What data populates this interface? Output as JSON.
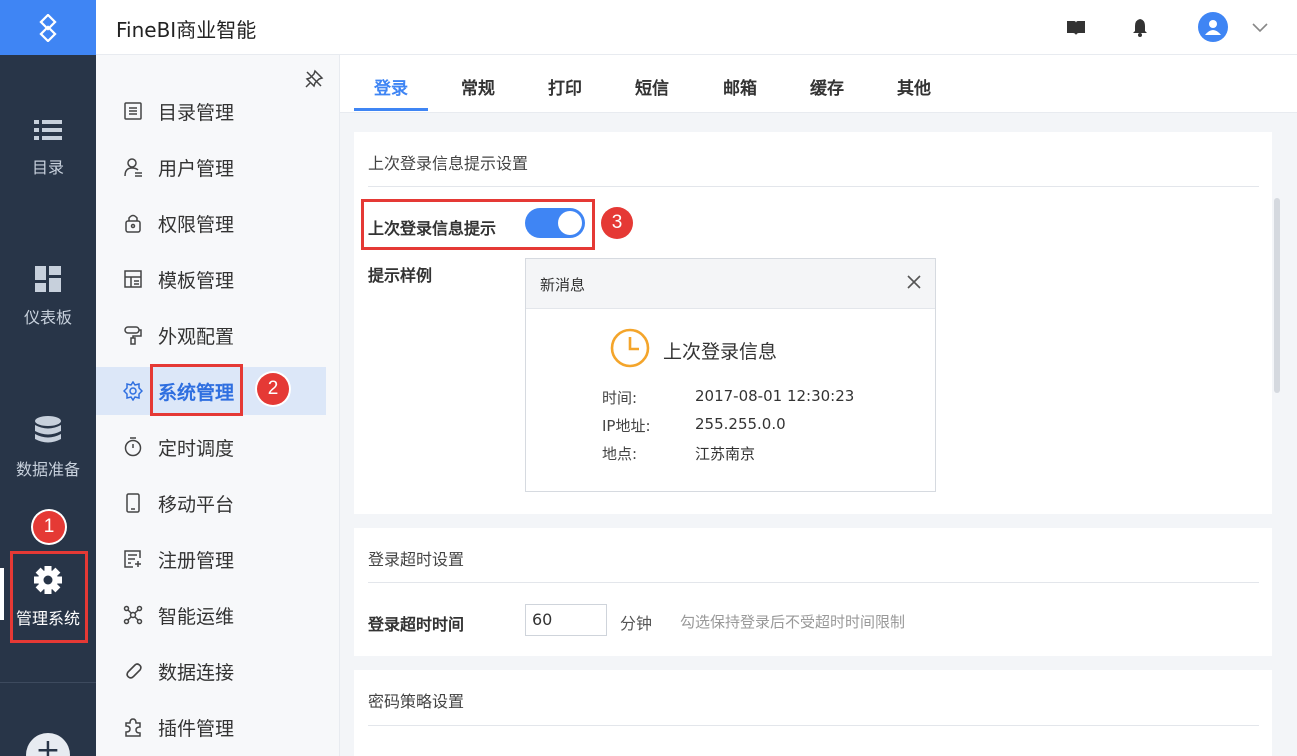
{
  "app": {
    "title": "FineBI商业智能"
  },
  "header": {
    "username": "",
    "icons": [
      "book-icon",
      "bell-icon",
      "user-avatar-icon",
      "chevron-down-icon"
    ]
  },
  "rail": {
    "items": [
      {
        "label": "目录",
        "icon": "list-icon"
      },
      {
        "label": "仪表板",
        "icon": "dashboard-icon"
      },
      {
        "label": "数据准备",
        "icon": "database-icon"
      },
      {
        "label": "管理系统",
        "icon": "gear-icon"
      }
    ],
    "plus": "+"
  },
  "menu": {
    "items": [
      {
        "label": "目录管理",
        "icon": "catalog-icon"
      },
      {
        "label": "用户管理",
        "icon": "user-icon"
      },
      {
        "label": "权限管理",
        "icon": "lock-icon"
      },
      {
        "label": "模板管理",
        "icon": "template-icon"
      },
      {
        "label": "外观配置",
        "icon": "paint-roller-icon"
      },
      {
        "label": "系统管理",
        "icon": "gear-icon"
      },
      {
        "label": "定时调度",
        "icon": "timer-icon"
      },
      {
        "label": "移动平台",
        "icon": "mobile-icon"
      },
      {
        "label": "注册管理",
        "icon": "register-icon"
      },
      {
        "label": "智能运维",
        "icon": "ops-icon"
      },
      {
        "label": "数据连接",
        "icon": "link-icon"
      },
      {
        "label": "插件管理",
        "icon": "plugin-icon"
      }
    ],
    "selected": "系统管理"
  },
  "tabs": [
    "登录",
    "常规",
    "打印",
    "短信",
    "邮箱",
    "缓存",
    "其他"
  ],
  "active_tab": "登录",
  "sections": {
    "last_login": {
      "title": "上次登录信息提示设置",
      "toggle_label": "上次登录信息提示",
      "toggle_on": true,
      "sample_label": "提示样例",
      "sample": {
        "header": "新消息",
        "title": "上次登录信息",
        "rows": [
          {
            "key": "时间:",
            "value": "2017-08-01 12:30:23"
          },
          {
            "key": "IP地址:",
            "value": "255.255.0.0"
          },
          {
            "key": "地点:",
            "value": "江苏南京"
          }
        ]
      }
    },
    "timeout": {
      "title": "登录超时设置",
      "label": "登录超时时间",
      "value": "60",
      "unit": "分钟",
      "hint": "勾选保持登录后不受超时时间限制"
    },
    "password": {
      "title": "密码策略设置"
    }
  },
  "annotations": [
    "1",
    "2",
    "3"
  ],
  "colors": {
    "accent": "#3f85f4",
    "rail": "#283548",
    "annotation": "#e53935"
  }
}
